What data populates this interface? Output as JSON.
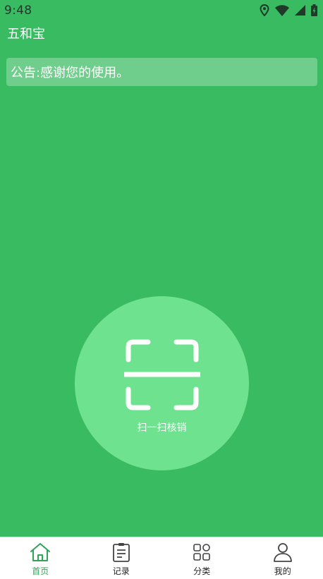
{
  "status_bar": {
    "time": "9:48",
    "icons": [
      "location-icon",
      "wifi-icon",
      "signal-icon",
      "battery-icon"
    ]
  },
  "app": {
    "title": "五和宝"
  },
  "notice": {
    "text": "公告:感谢您的使用。"
  },
  "scan": {
    "label": "扫一扫核销",
    "icon": "scan-icon"
  },
  "bottom_nav": {
    "items": [
      {
        "label": "首页",
        "icon": "home-icon",
        "active": true
      },
      {
        "label": "记录",
        "icon": "clipboard-icon",
        "active": false
      },
      {
        "label": "分类",
        "icon": "grid-icon",
        "active": false
      },
      {
        "label": "我的",
        "icon": "user-icon",
        "active": false
      }
    ]
  },
  "colors": {
    "background": "#39bb62",
    "scan_circle": "#6ee28f",
    "active_tab": "#2fa35a",
    "nav_background": "#ffffff"
  }
}
